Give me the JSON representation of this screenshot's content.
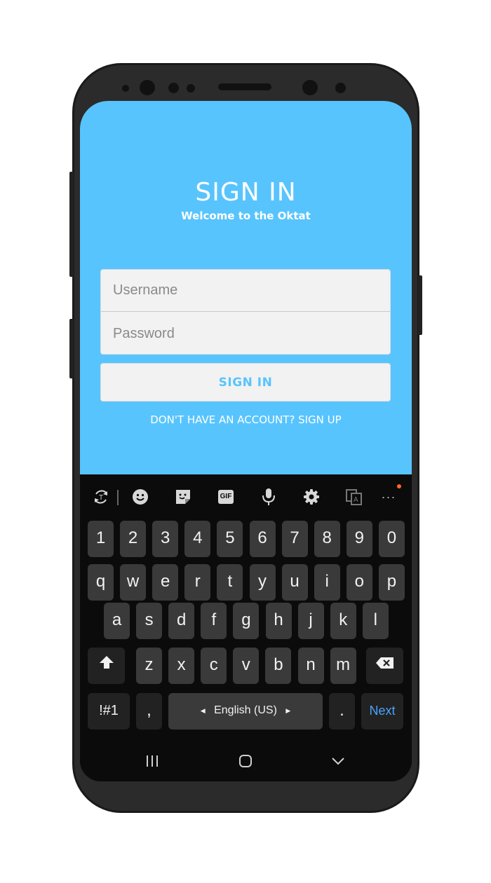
{
  "app": {
    "title": "SIGN IN",
    "subtitle": "Welcome to the Oktat",
    "username_placeholder": "Username",
    "password_placeholder": "Password",
    "signin_button": "SIGN IN",
    "signup_link": "DON'T HAVE AN ACCOUNT? SIGN UP",
    "accent": "#58c4fd"
  },
  "keyboard": {
    "toolbar": [
      "translate-icon",
      "emoji-icon",
      "sticker-icon",
      "gif-icon",
      "mic-icon",
      "settings-icon",
      "clipboard-icon",
      "more-icon"
    ],
    "gif_label": "GIF",
    "row1": [
      "1",
      "2",
      "3",
      "4",
      "5",
      "6",
      "7",
      "8",
      "9",
      "0"
    ],
    "row2": [
      "q",
      "w",
      "e",
      "r",
      "t",
      "y",
      "u",
      "i",
      "o",
      "p"
    ],
    "row3": [
      "a",
      "s",
      "d",
      "f",
      "g",
      "h",
      "j",
      "k",
      "l"
    ],
    "row4": [
      "z",
      "x",
      "c",
      "v",
      "b",
      "n",
      "m"
    ],
    "symbols_label": "!#1",
    "comma_label": ",",
    "space_label": "English (US)",
    "period_label": ".",
    "next_label": "Next",
    "next_color": "#4aa3ff"
  },
  "navigation": [
    "recents-icon",
    "home-icon",
    "back-icon"
  ]
}
